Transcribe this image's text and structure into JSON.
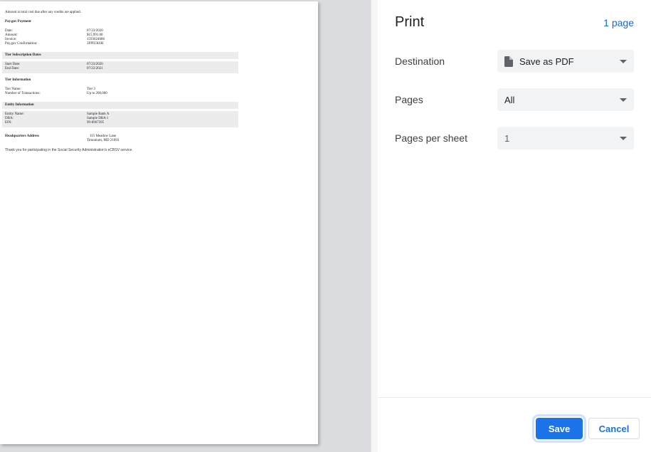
{
  "doc": {
    "intro": "Amount is total cost due after any credits are applied.",
    "sections": [
      {
        "title": "Pay.gov Payment",
        "shaded": false,
        "rows": [
          {
            "label": "Date:",
            "value": "07/23/2020"
          },
          {
            "label": "Amount:",
            "value": "$15,991.00"
          },
          {
            "label": "Invoice:",
            "value": "1593624686"
          },
          {
            "label": "Pay.gov Confirmation:",
            "value": "3FPIUK6H"
          }
        ]
      },
      {
        "title": "Tier Subscription Dates",
        "shaded": true,
        "rows": [
          {
            "label": "Start Date:",
            "value": "07/23/2020"
          },
          {
            "label": "End Date:",
            "value": "07/22/2021"
          }
        ]
      },
      {
        "title": "Tier Information",
        "shaded": false,
        "rows": [
          {
            "label": "Tier Name:",
            "value": "Tier 3"
          },
          {
            "label": "Number of Transactions:",
            "value": "Up to 200,000"
          }
        ]
      },
      {
        "title": "Entity Information",
        "shaded": true,
        "rows": [
          {
            "label": "Entity Name:",
            "value": "Sample Bank A"
          },
          {
            "label": "DBA:",
            "value": "Sample DBA 1"
          },
          {
            "label": "EIN:",
            "value": "99-8967395"
          }
        ]
      }
    ],
    "address": {
      "title": "Headquarters Address",
      "line1": "115 Meadow Lane",
      "line2": "Timonium, MD 21093"
    },
    "footer": "Thank you for participating in the Social Security Administration's eCBSV service."
  },
  "panel": {
    "title": "Print",
    "page_count": "1 page",
    "destination": {
      "label": "Destination",
      "value": "Save as PDF"
    },
    "pages": {
      "label": "Pages",
      "value": "All"
    },
    "pages_per_sheet": {
      "label": "Pages per sheet",
      "value": "1"
    },
    "save_label": "Save",
    "cancel_label": "Cancel"
  },
  "icons": {
    "destination": "pdf-file-icon",
    "selects": "chevron-down-icon"
  },
  "colors": {
    "accent_blue": "#1a73e8",
    "page_count_blue": "#1967d2",
    "dropdown_bg": "#f1f3f4",
    "preview_bg": "#dadce0",
    "doc_band_gray": "#ececec"
  }
}
